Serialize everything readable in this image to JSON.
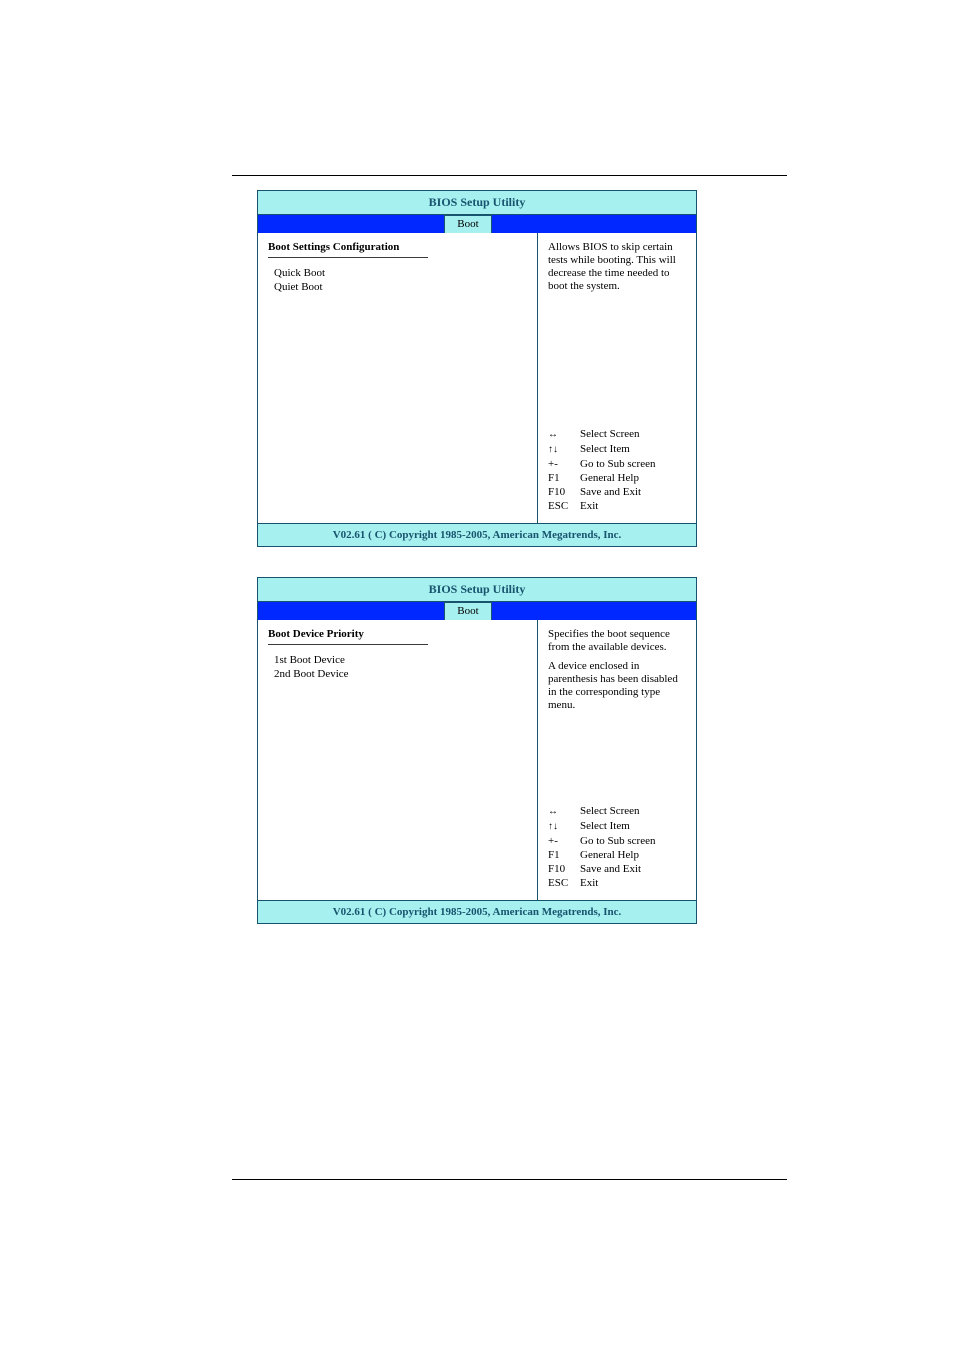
{
  "bios1": {
    "title": "BIOS Setup Utility",
    "tab": "Boot",
    "heading": "Boot Settings Configuration",
    "items": [
      "Quick Boot",
      "Quiet Boot"
    ],
    "help": "Allows BIOS to skip certain tests while booting. This will decrease the time needed to boot the system.",
    "keys": [
      {
        "k": "↔",
        "d": "Select Screen"
      },
      {
        "k": "↑↓",
        "d": "Select Item"
      },
      {
        "k": "+-",
        "d": "Go to Sub screen"
      },
      {
        "k": "F1",
        "d": "General Help"
      },
      {
        "k": "F10",
        "d": "Save and Exit"
      },
      {
        "k": "ESC",
        "d": "Exit"
      }
    ],
    "footer": "V02.61  ( C) Copyright 1985-2005, American Megatrends, Inc."
  },
  "bios2": {
    "title": "BIOS Setup Utility",
    "tab": "Boot",
    "heading": "Boot Device Priority",
    "items": [
      "1st Boot Device",
      "2nd Boot Device"
    ],
    "help1": "Specifies the boot sequence from the available devices.",
    "help2": "A device enclosed in parenthesis has been disabled in the corresponding type menu.",
    "keys": [
      {
        "k": "↔",
        "d": "Select Screen"
      },
      {
        "k": "↑↓",
        "d": "Select Item"
      },
      {
        "k": "+-",
        "d": "Go to Sub screen"
      },
      {
        "k": "F1",
        "d": "General Help"
      },
      {
        "k": "F10",
        "d": "Save and Exit"
      },
      {
        "k": "ESC",
        "d": "Exit"
      }
    ],
    "footer": "V02.61  ( C) Copyright 1985-2005, American Megatrends, Inc."
  }
}
